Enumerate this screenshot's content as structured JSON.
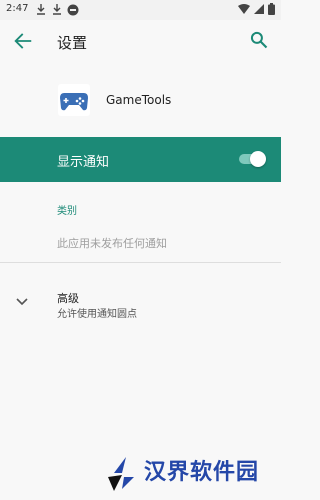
{
  "status_bar": {
    "time": "2:47",
    "icons": [
      "download-icon",
      "download-icon",
      "tool-icon",
      "wifi-icon",
      "signal-icon",
      "battery-icon"
    ]
  },
  "app_bar": {
    "title": "设置",
    "back_icon": "arrow-left-icon",
    "search_icon": "search-icon"
  },
  "app": {
    "name": "GameTools",
    "icon": "gamepad-icon"
  },
  "notifications": {
    "label": "显示通知",
    "enabled": true,
    "bar_color": "#1c8a77"
  },
  "category": {
    "title": "类别",
    "empty_text": "此应用未发布任何通知"
  },
  "advanced": {
    "title": "高级",
    "subtitle": "允许使用通知圆点",
    "icon": "chevron-down-icon"
  },
  "watermark": {
    "text": "汉界软件园",
    "color": "#2447a8"
  }
}
